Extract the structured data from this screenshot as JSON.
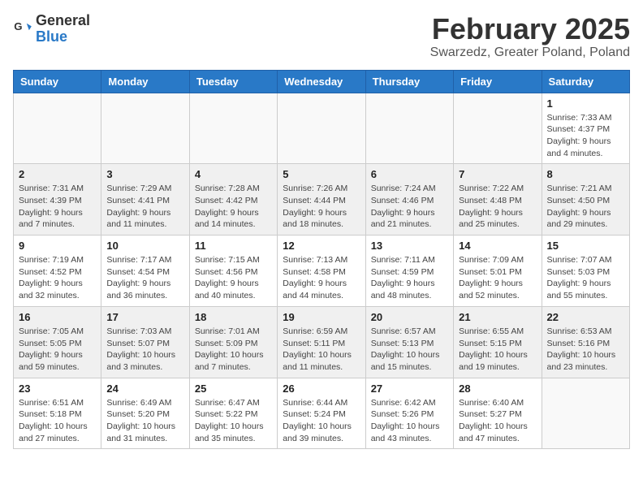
{
  "logo": {
    "text_general": "General",
    "text_blue": "Blue"
  },
  "title": "February 2025",
  "subtitle": "Swarzedz, Greater Poland, Poland",
  "days_of_week": [
    "Sunday",
    "Monday",
    "Tuesday",
    "Wednesday",
    "Thursday",
    "Friday",
    "Saturday"
  ],
  "weeks": [
    {
      "shade": false,
      "days": [
        {
          "num": "",
          "info": ""
        },
        {
          "num": "",
          "info": ""
        },
        {
          "num": "",
          "info": ""
        },
        {
          "num": "",
          "info": ""
        },
        {
          "num": "",
          "info": ""
        },
        {
          "num": "",
          "info": ""
        },
        {
          "num": "1",
          "info": "Sunrise: 7:33 AM\nSunset: 4:37 PM\nDaylight: 9 hours and 4 minutes."
        }
      ]
    },
    {
      "shade": true,
      "days": [
        {
          "num": "2",
          "info": "Sunrise: 7:31 AM\nSunset: 4:39 PM\nDaylight: 9 hours and 7 minutes."
        },
        {
          "num": "3",
          "info": "Sunrise: 7:29 AM\nSunset: 4:41 PM\nDaylight: 9 hours and 11 minutes."
        },
        {
          "num": "4",
          "info": "Sunrise: 7:28 AM\nSunset: 4:42 PM\nDaylight: 9 hours and 14 minutes."
        },
        {
          "num": "5",
          "info": "Sunrise: 7:26 AM\nSunset: 4:44 PM\nDaylight: 9 hours and 18 minutes."
        },
        {
          "num": "6",
          "info": "Sunrise: 7:24 AM\nSunset: 4:46 PM\nDaylight: 9 hours and 21 minutes."
        },
        {
          "num": "7",
          "info": "Sunrise: 7:22 AM\nSunset: 4:48 PM\nDaylight: 9 hours and 25 minutes."
        },
        {
          "num": "8",
          "info": "Sunrise: 7:21 AM\nSunset: 4:50 PM\nDaylight: 9 hours and 29 minutes."
        }
      ]
    },
    {
      "shade": false,
      "days": [
        {
          "num": "9",
          "info": "Sunrise: 7:19 AM\nSunset: 4:52 PM\nDaylight: 9 hours and 32 minutes."
        },
        {
          "num": "10",
          "info": "Sunrise: 7:17 AM\nSunset: 4:54 PM\nDaylight: 9 hours and 36 minutes."
        },
        {
          "num": "11",
          "info": "Sunrise: 7:15 AM\nSunset: 4:56 PM\nDaylight: 9 hours and 40 minutes."
        },
        {
          "num": "12",
          "info": "Sunrise: 7:13 AM\nSunset: 4:58 PM\nDaylight: 9 hours and 44 minutes."
        },
        {
          "num": "13",
          "info": "Sunrise: 7:11 AM\nSunset: 4:59 PM\nDaylight: 9 hours and 48 minutes."
        },
        {
          "num": "14",
          "info": "Sunrise: 7:09 AM\nSunset: 5:01 PM\nDaylight: 9 hours and 52 minutes."
        },
        {
          "num": "15",
          "info": "Sunrise: 7:07 AM\nSunset: 5:03 PM\nDaylight: 9 hours and 55 minutes."
        }
      ]
    },
    {
      "shade": true,
      "days": [
        {
          "num": "16",
          "info": "Sunrise: 7:05 AM\nSunset: 5:05 PM\nDaylight: 9 hours and 59 minutes."
        },
        {
          "num": "17",
          "info": "Sunrise: 7:03 AM\nSunset: 5:07 PM\nDaylight: 10 hours and 3 minutes."
        },
        {
          "num": "18",
          "info": "Sunrise: 7:01 AM\nSunset: 5:09 PM\nDaylight: 10 hours and 7 minutes."
        },
        {
          "num": "19",
          "info": "Sunrise: 6:59 AM\nSunset: 5:11 PM\nDaylight: 10 hours and 11 minutes."
        },
        {
          "num": "20",
          "info": "Sunrise: 6:57 AM\nSunset: 5:13 PM\nDaylight: 10 hours and 15 minutes."
        },
        {
          "num": "21",
          "info": "Sunrise: 6:55 AM\nSunset: 5:15 PM\nDaylight: 10 hours and 19 minutes."
        },
        {
          "num": "22",
          "info": "Sunrise: 6:53 AM\nSunset: 5:16 PM\nDaylight: 10 hours and 23 minutes."
        }
      ]
    },
    {
      "shade": false,
      "days": [
        {
          "num": "23",
          "info": "Sunrise: 6:51 AM\nSunset: 5:18 PM\nDaylight: 10 hours and 27 minutes."
        },
        {
          "num": "24",
          "info": "Sunrise: 6:49 AM\nSunset: 5:20 PM\nDaylight: 10 hours and 31 minutes."
        },
        {
          "num": "25",
          "info": "Sunrise: 6:47 AM\nSunset: 5:22 PM\nDaylight: 10 hours and 35 minutes."
        },
        {
          "num": "26",
          "info": "Sunrise: 6:44 AM\nSunset: 5:24 PM\nDaylight: 10 hours and 39 minutes."
        },
        {
          "num": "27",
          "info": "Sunrise: 6:42 AM\nSunset: 5:26 PM\nDaylight: 10 hours and 43 minutes."
        },
        {
          "num": "28",
          "info": "Sunrise: 6:40 AM\nSunset: 5:27 PM\nDaylight: 10 hours and 47 minutes."
        },
        {
          "num": "",
          "info": ""
        }
      ]
    }
  ]
}
